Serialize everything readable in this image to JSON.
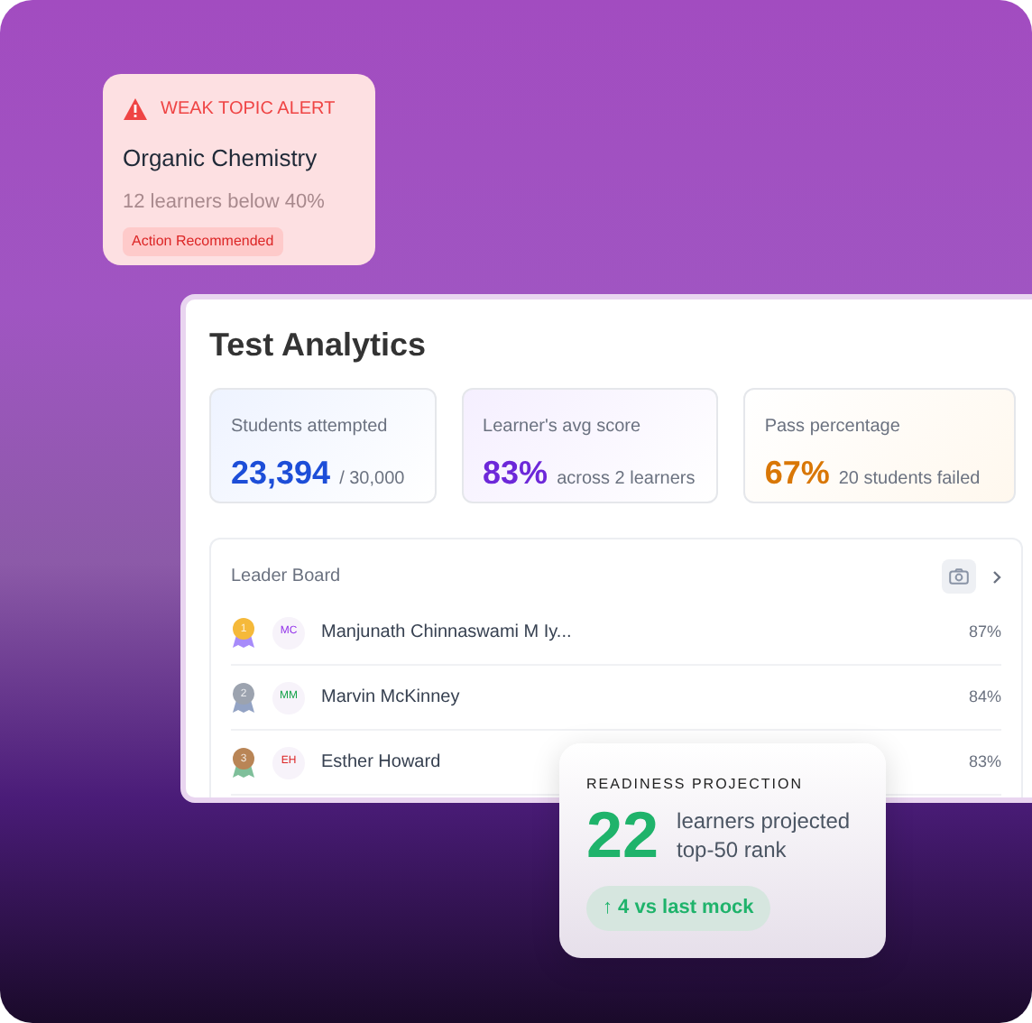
{
  "alert": {
    "label": "WEAK TOPIC ALERT",
    "topic": "Organic Chemistry",
    "detail": "12 learners below 40%",
    "badge": "Action Recommended"
  },
  "panel": {
    "title": "Test Analytics",
    "stats": [
      {
        "label": "Students attempted",
        "value": "23,394",
        "note": "/ 30,000",
        "color": "#1d4ed8"
      },
      {
        "label": "Learner's avg score",
        "value": "83%",
        "note": "across 2 learners",
        "color": "#6d28d9"
      },
      {
        "label": "Pass percentage",
        "value": "67%",
        "note": "20 students failed",
        "color": "#d97706"
      }
    ],
    "leaderboard": {
      "title": "Leader Board",
      "rows": [
        {
          "rank": "1",
          "kind": "gold",
          "initials": "MC",
          "color": "#9333ea",
          "name": "Manjunath Chinnaswami M Iy...",
          "score": "87%"
        },
        {
          "rank": "2",
          "kind": "silver",
          "initials": "MM",
          "color": "#16a34a",
          "name": "Marvin McKinney",
          "score": "84%"
        },
        {
          "rank": "3",
          "kind": "bronze",
          "initials": "EH",
          "color": "#dc2626",
          "name": "Esther Howard",
          "score": "83%"
        }
      ]
    }
  },
  "readiness": {
    "label": "READINESS PROJECTION",
    "value": "22",
    "caption": "learners projected top-50 rank",
    "trend": "↑ 4 vs last mock"
  }
}
